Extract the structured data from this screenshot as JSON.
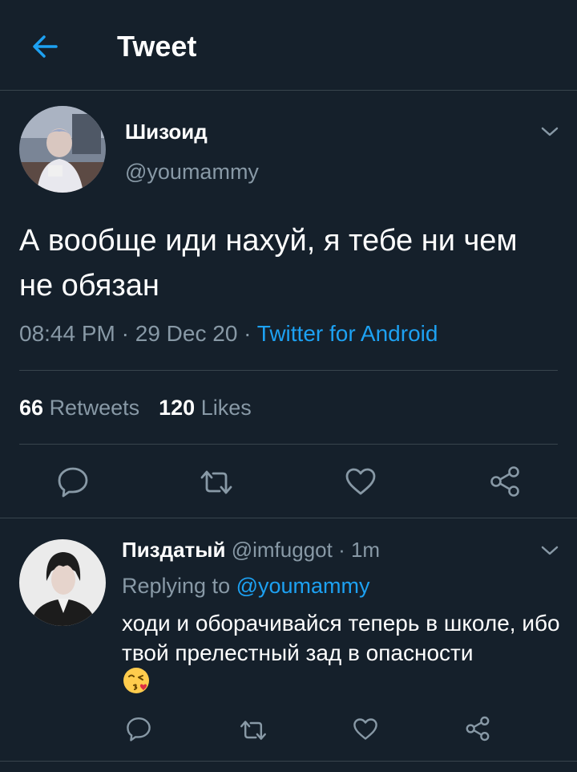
{
  "header": {
    "title": "Tweet",
    "back_icon": "arrow-left-icon",
    "accent_color": "#1da1f2"
  },
  "tweet": {
    "author_name": "Шизоид",
    "author_handle": "@youmammy",
    "text": "А вообще иди нахуй, я тебе ни чем не обязан",
    "time": "08:44 PM",
    "date": "29 Dec 20",
    "sep": " · ",
    "source": "Twitter for Android",
    "retweets_count": "66",
    "retweets_label": "Retweets",
    "likes_count": "120",
    "likes_label": "Likes"
  },
  "actions": {
    "reply_icon": "reply-bubble-icon",
    "retweet_icon": "retweet-icon",
    "like_icon": "heart-icon",
    "share_icon": "share-icon"
  },
  "reply": {
    "author_name": "Пиздатый",
    "author_handle": "@imfuggot",
    "dot": " · ",
    "time": "1m",
    "replying_prefix": "Replying to ",
    "replying_to": "@youmammy",
    "text": "ходи и оборачивайся теперь в школе, ибо твой прелестный зад в опасности",
    "emoji": "kissing-heart-emoji"
  },
  "colors": {
    "background": "#15202b",
    "secondary_text": "#8899a6",
    "divider": "#38444d"
  }
}
